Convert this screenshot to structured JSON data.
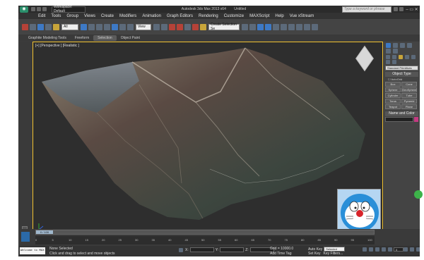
{
  "title": {
    "workspace": "Workspace: Default",
    "app": "Autodesk 3ds Max  2013 x64",
    "doc": "Untitled",
    "search_placeholder": "Type a keyword or phrase"
  },
  "menu": [
    "Edit",
    "Tools",
    "Group",
    "Views",
    "Create",
    "Modifiers",
    "Animation",
    "Graph Editors",
    "Rendering",
    "Customize",
    "MAXScript",
    "Help",
    "Vue xStream"
  ],
  "toolbar": {
    "filter": "All",
    "view": "View",
    "selection_set": "Create Selection Se"
  },
  "ribbon": {
    "tabs": [
      "Graphite Modeling Tools",
      "Freeform",
      "Selection",
      "Object Paint"
    ],
    "active": "Selection"
  },
  "viewport": {
    "label": "[+] [Perspective ] [Realistic ]"
  },
  "command_panel": {
    "category": "Standard Primitives",
    "object_type_header": "Object Type",
    "autogrid": "AutoGrid",
    "buttons": [
      "Box",
      "Cone",
      "Sphere",
      "GeoSphere",
      "Cylinder",
      "Tube",
      "Torus",
      "Pyramid",
      "Teapot",
      "Plane"
    ],
    "name_color_header": "Name and Color"
  },
  "timeline": {
    "frame": "0 / 100",
    "ticks": [
      "0",
      "5",
      "10",
      "15",
      "20",
      "25",
      "30",
      "35",
      "40",
      "45",
      "50",
      "55",
      "60",
      "65",
      "70",
      "75",
      "80",
      "85",
      "90",
      "95",
      "100"
    ]
  },
  "status": {
    "listener": "Welcome to MAX",
    "selection": "None Selected",
    "prompt": "Click and drag to select and move objects",
    "x_label": "X:",
    "y_label": "Y:",
    "z_label": "Z:",
    "grid": "Grid = 10000.0",
    "add_time_tag": "Add Time Tag",
    "autokey": "Auto Key",
    "selected": "Selected",
    "setkey": "Set Key",
    "key_filters": "Key Filters...",
    "frame": "0"
  },
  "colors": {
    "accent": "#f2c230",
    "panel": "#444444",
    "viewport_bg": "#2e2e2e"
  }
}
